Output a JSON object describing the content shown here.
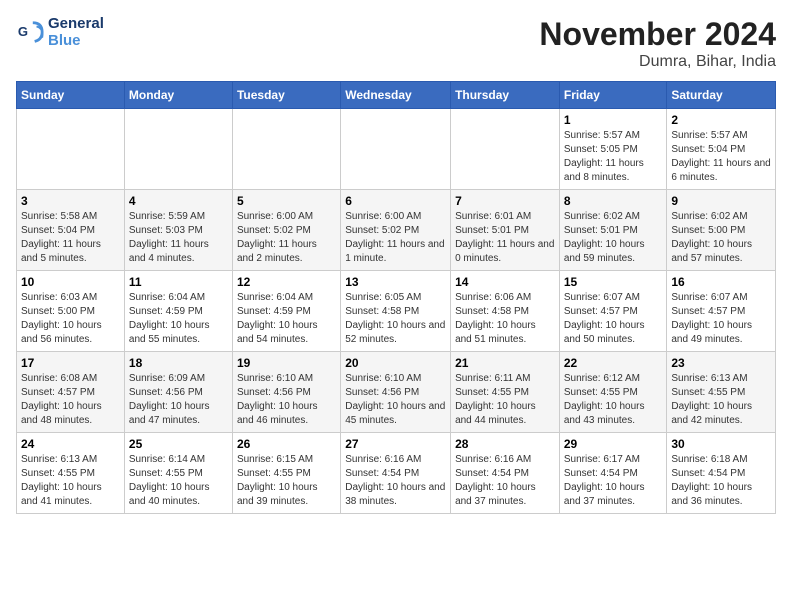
{
  "header": {
    "logo_line1": "General",
    "logo_line2": "Blue",
    "month_title": "November 2024",
    "location": "Dumra, Bihar, India"
  },
  "weekdays": [
    "Sunday",
    "Monday",
    "Tuesday",
    "Wednesday",
    "Thursday",
    "Friday",
    "Saturday"
  ],
  "weeks": [
    [
      {
        "day": "",
        "info": ""
      },
      {
        "day": "",
        "info": ""
      },
      {
        "day": "",
        "info": ""
      },
      {
        "day": "",
        "info": ""
      },
      {
        "day": "",
        "info": ""
      },
      {
        "day": "1",
        "info": "Sunrise: 5:57 AM\nSunset: 5:05 PM\nDaylight: 11 hours and 8 minutes."
      },
      {
        "day": "2",
        "info": "Sunrise: 5:57 AM\nSunset: 5:04 PM\nDaylight: 11 hours and 6 minutes."
      }
    ],
    [
      {
        "day": "3",
        "info": "Sunrise: 5:58 AM\nSunset: 5:04 PM\nDaylight: 11 hours and 5 minutes."
      },
      {
        "day": "4",
        "info": "Sunrise: 5:59 AM\nSunset: 5:03 PM\nDaylight: 11 hours and 4 minutes."
      },
      {
        "day": "5",
        "info": "Sunrise: 6:00 AM\nSunset: 5:02 PM\nDaylight: 11 hours and 2 minutes."
      },
      {
        "day": "6",
        "info": "Sunrise: 6:00 AM\nSunset: 5:02 PM\nDaylight: 11 hours and 1 minute."
      },
      {
        "day": "7",
        "info": "Sunrise: 6:01 AM\nSunset: 5:01 PM\nDaylight: 11 hours and 0 minutes."
      },
      {
        "day": "8",
        "info": "Sunrise: 6:02 AM\nSunset: 5:01 PM\nDaylight: 10 hours and 59 minutes."
      },
      {
        "day": "9",
        "info": "Sunrise: 6:02 AM\nSunset: 5:00 PM\nDaylight: 10 hours and 57 minutes."
      }
    ],
    [
      {
        "day": "10",
        "info": "Sunrise: 6:03 AM\nSunset: 5:00 PM\nDaylight: 10 hours and 56 minutes."
      },
      {
        "day": "11",
        "info": "Sunrise: 6:04 AM\nSunset: 4:59 PM\nDaylight: 10 hours and 55 minutes."
      },
      {
        "day": "12",
        "info": "Sunrise: 6:04 AM\nSunset: 4:59 PM\nDaylight: 10 hours and 54 minutes."
      },
      {
        "day": "13",
        "info": "Sunrise: 6:05 AM\nSunset: 4:58 PM\nDaylight: 10 hours and 52 minutes."
      },
      {
        "day": "14",
        "info": "Sunrise: 6:06 AM\nSunset: 4:58 PM\nDaylight: 10 hours and 51 minutes."
      },
      {
        "day": "15",
        "info": "Sunrise: 6:07 AM\nSunset: 4:57 PM\nDaylight: 10 hours and 50 minutes."
      },
      {
        "day": "16",
        "info": "Sunrise: 6:07 AM\nSunset: 4:57 PM\nDaylight: 10 hours and 49 minutes."
      }
    ],
    [
      {
        "day": "17",
        "info": "Sunrise: 6:08 AM\nSunset: 4:57 PM\nDaylight: 10 hours and 48 minutes."
      },
      {
        "day": "18",
        "info": "Sunrise: 6:09 AM\nSunset: 4:56 PM\nDaylight: 10 hours and 47 minutes."
      },
      {
        "day": "19",
        "info": "Sunrise: 6:10 AM\nSunset: 4:56 PM\nDaylight: 10 hours and 46 minutes."
      },
      {
        "day": "20",
        "info": "Sunrise: 6:10 AM\nSunset: 4:56 PM\nDaylight: 10 hours and 45 minutes."
      },
      {
        "day": "21",
        "info": "Sunrise: 6:11 AM\nSunset: 4:55 PM\nDaylight: 10 hours and 44 minutes."
      },
      {
        "day": "22",
        "info": "Sunrise: 6:12 AM\nSunset: 4:55 PM\nDaylight: 10 hours and 43 minutes."
      },
      {
        "day": "23",
        "info": "Sunrise: 6:13 AM\nSunset: 4:55 PM\nDaylight: 10 hours and 42 minutes."
      }
    ],
    [
      {
        "day": "24",
        "info": "Sunrise: 6:13 AM\nSunset: 4:55 PM\nDaylight: 10 hours and 41 minutes."
      },
      {
        "day": "25",
        "info": "Sunrise: 6:14 AM\nSunset: 4:55 PM\nDaylight: 10 hours and 40 minutes."
      },
      {
        "day": "26",
        "info": "Sunrise: 6:15 AM\nSunset: 4:55 PM\nDaylight: 10 hours and 39 minutes."
      },
      {
        "day": "27",
        "info": "Sunrise: 6:16 AM\nSunset: 4:54 PM\nDaylight: 10 hours and 38 minutes."
      },
      {
        "day": "28",
        "info": "Sunrise: 6:16 AM\nSunset: 4:54 PM\nDaylight: 10 hours and 37 minutes."
      },
      {
        "day": "29",
        "info": "Sunrise: 6:17 AM\nSunset: 4:54 PM\nDaylight: 10 hours and 37 minutes."
      },
      {
        "day": "30",
        "info": "Sunrise: 6:18 AM\nSunset: 4:54 PM\nDaylight: 10 hours and 36 minutes."
      }
    ]
  ]
}
